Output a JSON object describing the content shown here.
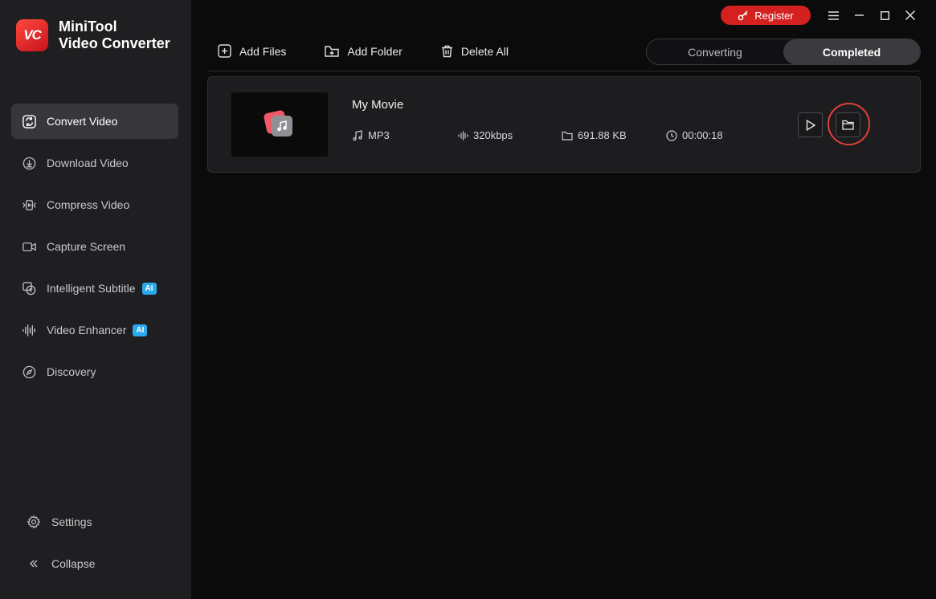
{
  "brand": {
    "logo_text": "VC",
    "line1": "MiniTool",
    "line2": "Video Converter"
  },
  "sidebar": {
    "items": [
      {
        "label": "Convert Video",
        "icon": "convert-icon",
        "active": true
      },
      {
        "label": "Download Video",
        "icon": "download-icon"
      },
      {
        "label": "Compress Video",
        "icon": "compress-icon"
      },
      {
        "label": "Capture Screen",
        "icon": "camera-icon"
      },
      {
        "label": "Intelligent Subtitle",
        "icon": "subtitle-icon",
        "badge": "AI"
      },
      {
        "label": "Video Enhancer",
        "icon": "waveform-icon",
        "badge": "AI"
      },
      {
        "label": "Discovery",
        "icon": "compass-icon"
      }
    ],
    "settings_label": "Settings",
    "collapse_label": "Collapse"
  },
  "titlebar": {
    "register_label": "Register"
  },
  "toolbar": {
    "add_files": "Add Files",
    "add_folder": "Add Folder",
    "delete_all": "Delete All"
  },
  "tabs": {
    "converting": "Converting",
    "completed": "Completed",
    "active": "completed"
  },
  "file": {
    "name": "My Movie",
    "format": "MP3",
    "bitrate": "320kbps",
    "size": "691.88 KB",
    "duration": "00:00:18"
  },
  "colors": {
    "accent": "#d52020",
    "ai_badge": "#2aa9ee",
    "highlight": "#e0403a"
  }
}
